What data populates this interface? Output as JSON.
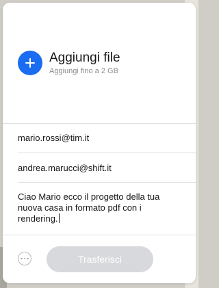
{
  "add_files": {
    "title": "Aggiungi file",
    "subtitle": "Aggiungi fino a 2 GB",
    "icon": "plus-icon"
  },
  "form": {
    "recipient_email": "mario.rossi@tim.it",
    "sender_email": "andrea.marucci@shift.it",
    "message": "Ciao Mario ecco il progetto della tua nuova casa in formato pdf con i rendering."
  },
  "footer": {
    "more_icon": "more-options-icon",
    "transfer_label": "Trasferisci"
  },
  "colors": {
    "accent": "#1a6cf0",
    "disabled_button": "#d8d9dc"
  }
}
